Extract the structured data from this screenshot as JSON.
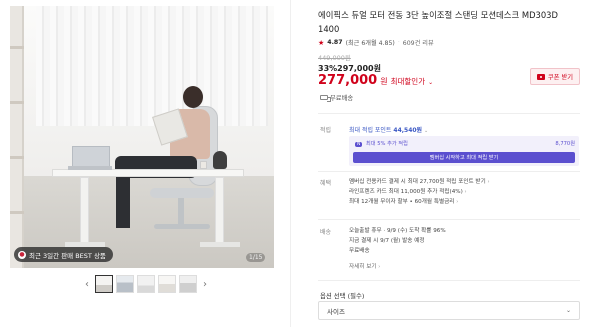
{
  "gallery": {
    "badge_text": "최근 3일간 판매 BEST 상품",
    "counter": "1/15",
    "prev_arrow": "‹",
    "next_arrow": "›"
  },
  "product": {
    "title": "에이픽스 듀얼 모터 전동 3단 높이조절 스탠딩 모션데스크 MD303D 1400",
    "rating": "4.87",
    "rating_detail": "(최근 6개월 4.85)",
    "review_link": "609건 리뷰",
    "original_price": "449,000원",
    "discount_line": "33%297,000원",
    "sale_price": "277,000",
    "currency": "원",
    "price_tag": "최대할인가",
    "coupon_label": "쿠폰 받기",
    "shipping": "무료배송"
  },
  "points": {
    "label": "적립",
    "headline": "최대 적립 포인트",
    "amount": "44,540원",
    "extra_label": "최대 5% 추가 적립",
    "extra_amount": "8,770원",
    "extra_tag": "N",
    "member_cta": "멤버십 시작하고 최대 적립 받기"
  },
  "benefits": {
    "label": "혜택",
    "line1": "멤버십 전용카드 결제 시 최대 27,700원 적립 포인트 받기",
    "line2": "라인프렌즈 카드 최대 11,000원 추가 적립(4%)",
    "line3": "최대 12개월 무이자 할부 • 60개월 특별금리"
  },
  "delivery": {
    "label": "배송",
    "line1": "오늘출발 휴무 · 9/9 (수) 도착 확률 96%",
    "line2": "지금 결제 시 9/7 (월) 발송 예정",
    "line3": "무료배송",
    "more": "자세히 보기"
  },
  "options": {
    "title": "옵션 선택 (필수)",
    "select_value": "사이즈"
  }
}
